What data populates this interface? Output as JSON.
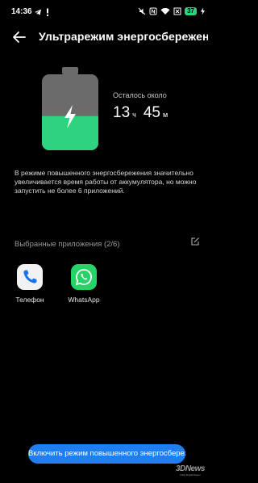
{
  "status_bar": {
    "time": "14:36",
    "battery_level": "37"
  },
  "app_bar": {
    "title": "Ультрарежим энергосбережения"
  },
  "battery": {
    "charge_fraction": 0.45,
    "fill_color": "#2fd37f",
    "empty_color": "#6b6b6b"
  },
  "remaining": {
    "label": "Осталось около",
    "hours": "13",
    "hours_unit": "ч",
    "minutes": "45",
    "minutes_unit": "м"
  },
  "description": "В режиме повышенного энергосбережения значительно увеличивается время работы от аккумулятора, но можно запустить не более 6 приложений.",
  "selected_apps": {
    "title": "Выбранные приложения (2/6)",
    "apps": [
      {
        "name": "Телефон",
        "icon": "phone-icon",
        "color": "#1a73e8"
      },
      {
        "name": "WhatsApp",
        "icon": "whatsapp-icon",
        "color": "#25d366"
      }
    ]
  },
  "enable_button": {
    "label": "Включить режим повышенного энергосбережения"
  },
  "watermark": {
    "logo": "3DNews",
    "tagline": "Daily Digital Digest"
  }
}
